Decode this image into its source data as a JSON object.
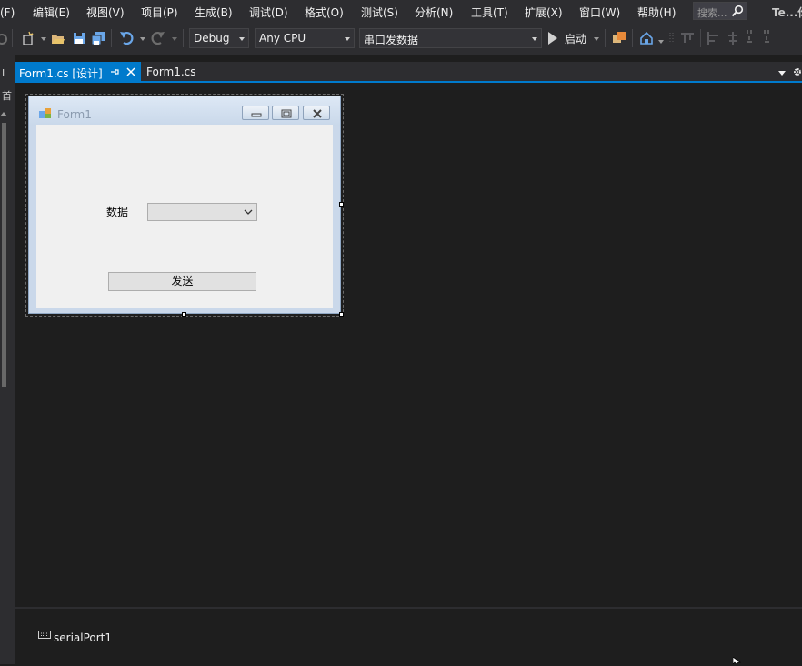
{
  "menu": {
    "items": [
      "文件(F)",
      "编辑(E)",
      "视图(V)",
      "项目(P)",
      "生成(B)",
      "调试(D)",
      "格式(O)",
      "测试(S)",
      "分析(N)",
      "工具(T)",
      "扩展(X)",
      "窗口(W)",
      "帮助(H)"
    ],
    "search_placeholder": "搜索...",
    "brand_text": "Te...你"
  },
  "toolbar": {
    "config": "Debug",
    "platform": "Any CPU",
    "project": "串口发数据",
    "start_label": "启动"
  },
  "tabs": {
    "active_label": "Form1.cs [设计]",
    "inactive_label": "Form1.cs"
  },
  "left_strip": {
    "chars": [
      "I",
      "首"
    ]
  },
  "form": {
    "title": "Form1",
    "data_label": "数据",
    "combo_value": "",
    "send_button": "发送"
  },
  "tray": {
    "component": "serialPort1"
  },
  "colors": {
    "ide_bg": "#1e1e1e",
    "chrome_bg": "#2d2d30",
    "accent": "#007acc",
    "form_client": "#f0f0f0"
  }
}
